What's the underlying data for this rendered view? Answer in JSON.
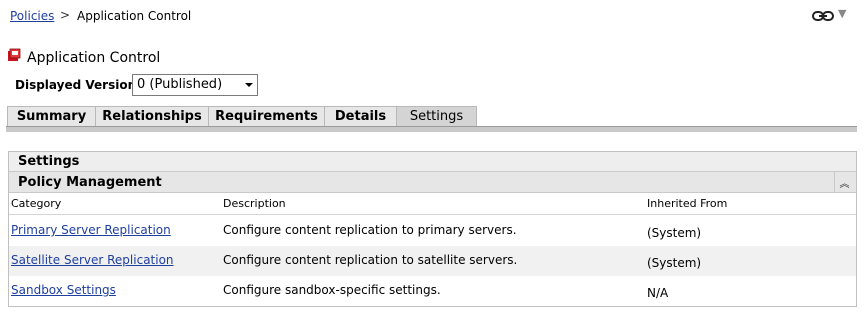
{
  "breadcrumb": {
    "parent": "Policies",
    "separator": ">",
    "current": "Application Control"
  },
  "header": {
    "title": "Application Control",
    "link_icon": "link-chain-icon",
    "menu_icon": "dropdown-arrow-icon"
  },
  "version": {
    "label": "Displayed Version:",
    "selected": "0 (Published)"
  },
  "tabs": [
    {
      "label": "Summary",
      "active": false
    },
    {
      "label": "Relationships",
      "active": false
    },
    {
      "label": "Requirements",
      "active": false
    },
    {
      "label": "Details",
      "active": false
    },
    {
      "label": "Settings",
      "active": true
    }
  ],
  "panel": {
    "title": "Settings",
    "section_title": "Policy Management",
    "columns": [
      "Category",
      "Description",
      "Inherited From"
    ],
    "rows": [
      {
        "category": "Primary Server Replication",
        "description": "Configure content replication to primary servers.",
        "inherited": "(System)"
      },
      {
        "category": "Satellite Server Replication",
        "description": "Configure content replication to satellite servers.",
        "inherited": "(System)"
      },
      {
        "category": "Sandbox Settings",
        "description": "Configure sandbox-specific settings.",
        "inherited": "N/A"
      }
    ]
  },
  "colors": {
    "link": "#1f3f9f",
    "tab_bg": "#e7e7e7",
    "tab_active_bg": "#d4d4d4",
    "section_bg": "#e6e6e6"
  }
}
